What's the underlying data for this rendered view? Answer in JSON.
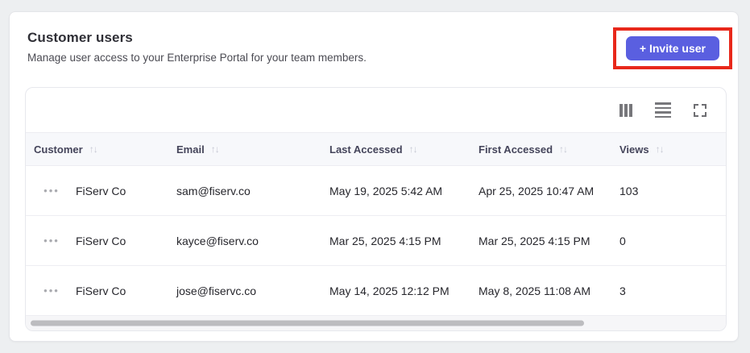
{
  "colors": {
    "accent": "#5a5fe0",
    "annotation": "#e8281b",
    "header_row_bg": "#f7f8fb",
    "page_bg": "#edeff1"
  },
  "header": {
    "title": "Customer users",
    "subtitle": "Manage user access to your Enterprise Portal for your team members.",
    "invite_button_label": "+ Invite user"
  },
  "toolbar": {
    "icons": [
      "column-visibility",
      "row-density",
      "fullscreen"
    ]
  },
  "table": {
    "sort_icon": "↑↓",
    "row_menu_icon": "•••",
    "columns": [
      {
        "label": "Customer"
      },
      {
        "label": "Email"
      },
      {
        "label": "Last Accessed"
      },
      {
        "label": "First Accessed"
      },
      {
        "label": "Views"
      }
    ],
    "rows": [
      {
        "customer": "FiServ Co",
        "email": "sam@fiserv.co",
        "last_accessed": "May 19, 2025 5:42 AM",
        "first_accessed": "Apr 25, 2025 10:47 AM",
        "views": "103"
      },
      {
        "customer": "FiServ Co",
        "email": "kayce@fiserv.co",
        "last_accessed": "Mar 25, 2025 4:15 PM",
        "first_accessed": "Mar 25, 2025 4:15 PM",
        "views": "0"
      },
      {
        "customer": "FiServ Co",
        "email": "jose@fiservc.co",
        "last_accessed": "May 14, 2025 12:12 PM",
        "first_accessed": "May 8, 2025 11:08 AM",
        "views": "3"
      }
    ]
  }
}
